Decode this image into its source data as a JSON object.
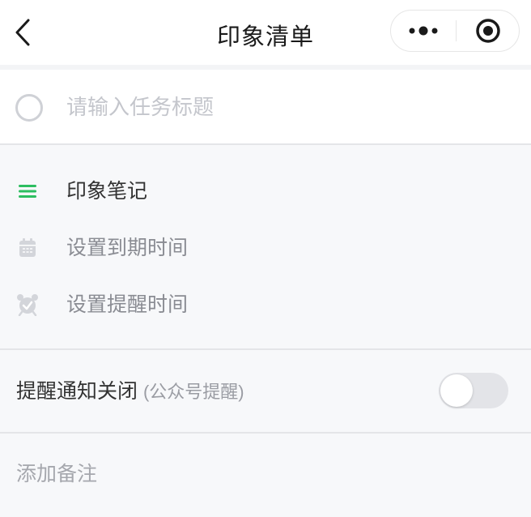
{
  "navbar": {
    "title": "印象清单",
    "back_icon": "chevron-left-icon",
    "more_icon": "more-dots-icon",
    "close_icon": "target-circle-icon"
  },
  "task": {
    "placeholder": "请输入任务标题",
    "value": ""
  },
  "options": [
    {
      "label": "印象笔记",
      "icon": "list-icon",
      "icon_color": "#2dbe60"
    },
    {
      "label": "设置到期时间",
      "icon": "calendar-icon",
      "icon_color": "#d3d5da"
    },
    {
      "label": "设置提醒时间",
      "icon": "alarm-clock-icon",
      "icon_color": "#d3d5da"
    }
  ],
  "notify": {
    "label": "提醒通知关闭",
    "sub_label": "(公众号提醒)",
    "enabled": false
  },
  "memo": {
    "label": "添加备注"
  },
  "colors": {
    "accent_green": "#2dbe60",
    "background": "#f7f8fa"
  }
}
